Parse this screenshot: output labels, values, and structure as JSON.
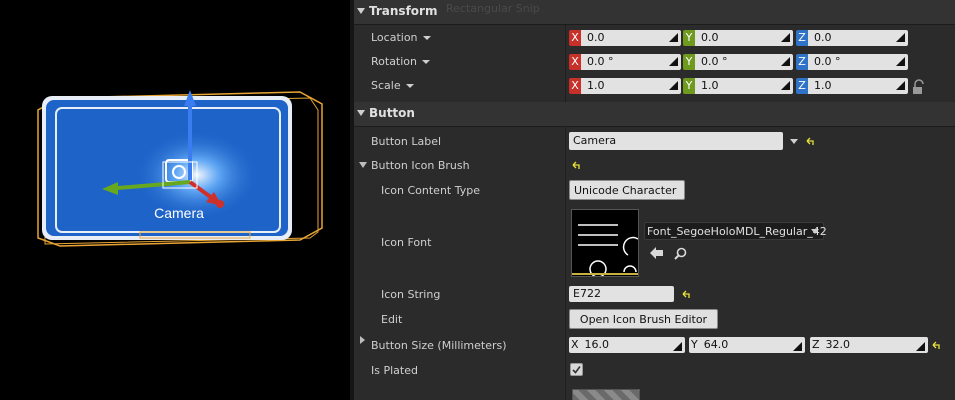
{
  "viewport": {
    "button_caption": "Camera"
  },
  "ghost_text": "Rectangular Snip",
  "transform": {
    "title": "Transform",
    "location_label": "Location",
    "rotation_label": "Rotation",
    "scale_label": "Scale",
    "location": {
      "x": "0.0",
      "y": "0.0",
      "z": "0.0"
    },
    "rotation": {
      "x": "0.0 °",
      "y": "0.0 °",
      "z": "0.0 °"
    },
    "scale": {
      "x": "1.0",
      "y": "1.0",
      "z": "1.0"
    }
  },
  "button": {
    "title": "Button",
    "label_label": "Button Label",
    "label_value": "Camera",
    "icon_brush_label": "Button Icon Brush",
    "content_type_label": "Icon Content Type",
    "content_type_value": "Unicode Character",
    "icon_font_label": "Icon Font",
    "icon_font_value": "Font_SegoeHoloMDL_Regular_42",
    "icon_string_label": "Icon String",
    "icon_string_value": "E722",
    "edit_label": "Edit",
    "edit_button": "Open Icon Brush Editor",
    "size_label": "Button Size (Millimeters)",
    "size": {
      "x_tag": "X",
      "x": "16.0",
      "y_tag": "Y",
      "y": "64.0",
      "z_tag": "Z",
      "z": "32.0"
    },
    "plated_label": "Is Plated",
    "plated": true
  },
  "axis_tags": {
    "x": "X",
    "y": "Y",
    "z": "Z"
  },
  "colors": {
    "x_axis": "#c8302a",
    "y_axis": "#6f9a1e",
    "z_axis": "#2f72c6",
    "selection": "#e8a534",
    "button_blue": "#1e63c8"
  },
  "icons": [
    "expand-arrow-icon",
    "reset-arrow-icon",
    "lock-icon",
    "use-selected-arrow-icon",
    "browse-magnifier-icon",
    "checkmark-icon"
  ]
}
